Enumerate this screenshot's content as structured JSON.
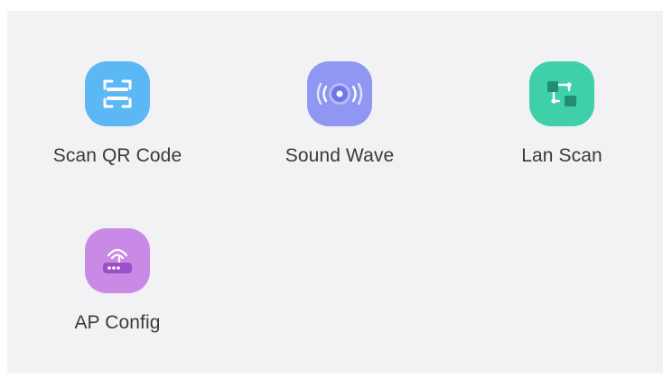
{
  "options": [
    {
      "label": "Scan QR Code",
      "icon": "qr-scan-icon",
      "color": "#5cb8f5"
    },
    {
      "label": "Sound Wave",
      "icon": "sound-wave-icon",
      "color": "#8f97f2"
    },
    {
      "label": "Lan Scan",
      "icon": "lan-scan-icon",
      "color": "#3fd0a9"
    },
    {
      "label": "AP Config",
      "icon": "router-icon",
      "color": "#c98ae6"
    }
  ]
}
